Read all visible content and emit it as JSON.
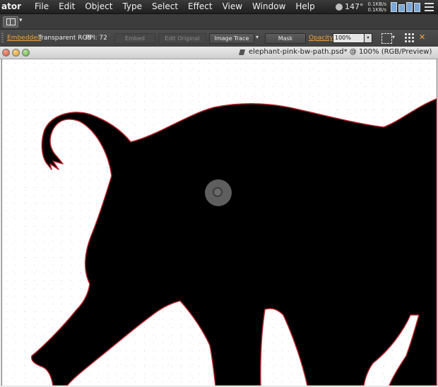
{
  "menubar": {
    "app": "ator",
    "items": [
      "File",
      "Edit",
      "Object",
      "Type",
      "Select",
      "Effect",
      "View",
      "Window",
      "Help"
    ],
    "status": {
      "temperature": "147°",
      "net_up": "0.1KB/s",
      "net_down": "0.1KB/s",
      "sun_icon": "weather-sun-icon",
      "meter_icon": "system-meter-icon",
      "menu_icon": "menu-extra-icon"
    }
  },
  "workspace": {
    "switcher_icon": "workspace-grid-icon",
    "caret": "▾"
  },
  "controlbar": {
    "embedded_label": "Embedded",
    "color_mode": "Transparent RGB",
    "ppi": "PPI: 72",
    "embed_btn": "Embed",
    "edit_original_btn": "Edit Original",
    "image_trace_btn": "Image Trace",
    "trace_caret": "▾",
    "mask_btn": "Mask",
    "opacity_label": "Opacity:",
    "opacity_value": "100%",
    "opacity_drop": "▾",
    "align_icon": "align-dropdown-icon",
    "align_caret": "▾",
    "transform_icon": "transform-grid-icon",
    "wand_icon": "magic-wand-icon"
  },
  "document": {
    "title": "elephant-pink-bw-path.psd* @ 100% (RGB/Preview)",
    "colors": {
      "silhouette": "#000000",
      "edge": "#b3262b",
      "canvas": "#ffffff"
    }
  }
}
